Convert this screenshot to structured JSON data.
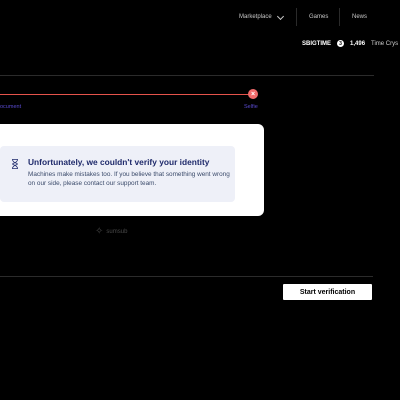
{
  "nav": {
    "marketplace": "Marketplace",
    "games": "Games",
    "news": "News"
  },
  "stats": {
    "ticker": "SBIGTIME",
    "coin_symbol": "3",
    "amount": "1,496",
    "label": "Time Crys"
  },
  "progress": {
    "left_label": "ocument",
    "right_label": "Selfie"
  },
  "dialog": {
    "title": "Unfortunately, we couldn't verify your identity",
    "body": "Machines make mistakes too. If you believe that something went wrong on our side, please contact our support team."
  },
  "powered_by": "sumsub",
  "actions": {
    "start": "Start verification"
  },
  "colors": {
    "accent_red": "#e5534b",
    "step_purple": "#5a4bd1",
    "title_navy": "#1f2a6b"
  }
}
